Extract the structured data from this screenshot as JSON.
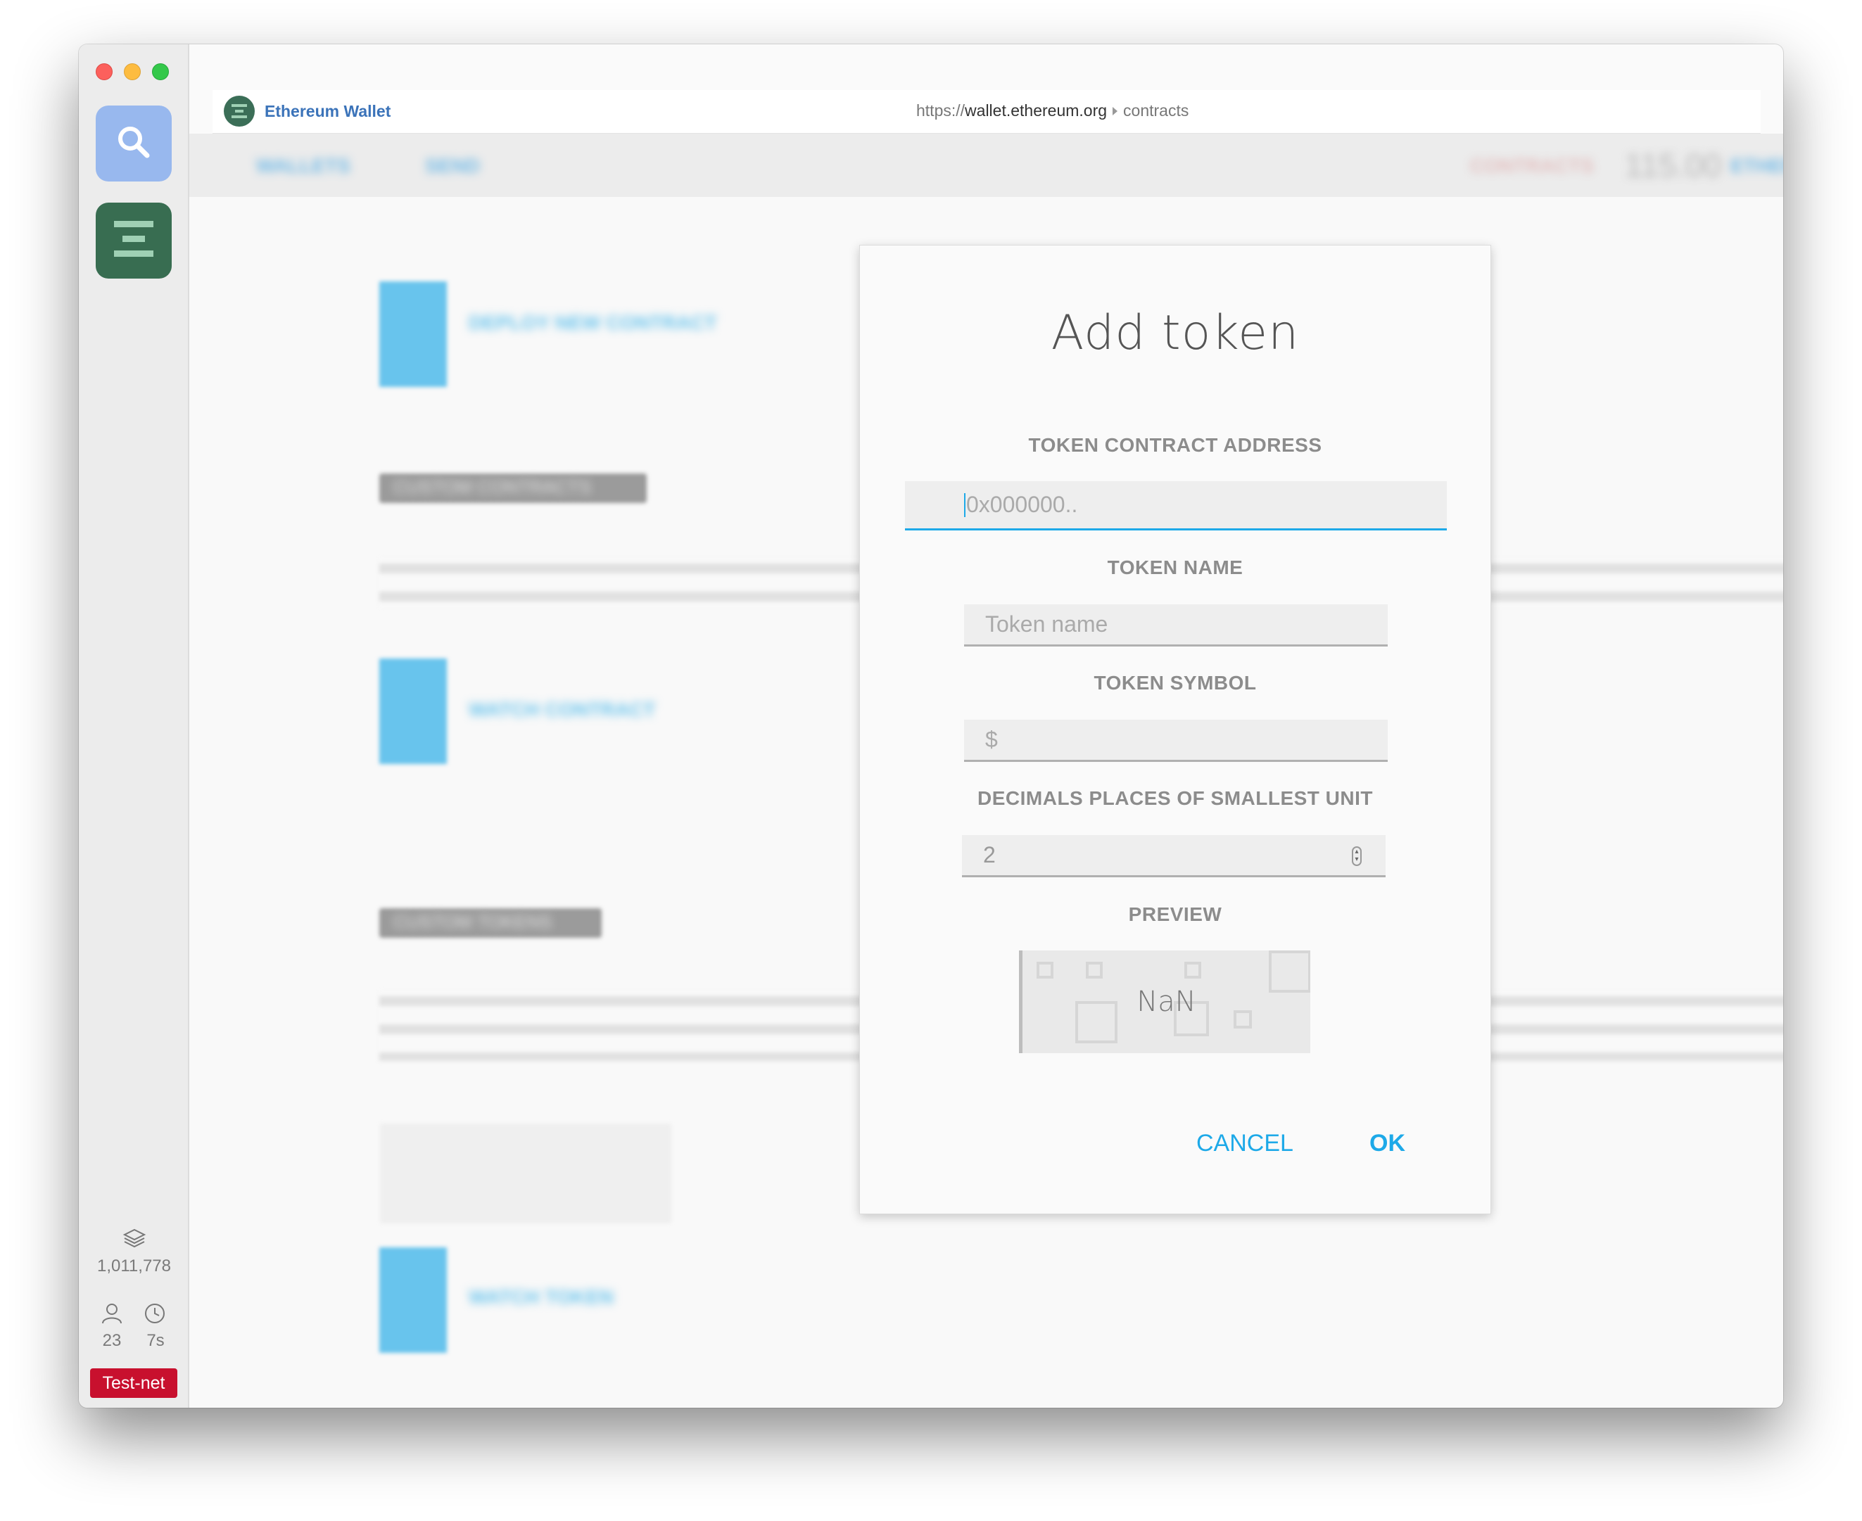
{
  "sidebar": {
    "block_number": "1,011,778",
    "peers": "23",
    "last_block": "7s",
    "network": "Test-net"
  },
  "browser": {
    "app_name": "Ethereum Wallet",
    "url_scheme": "https://",
    "url_domain": "wallet.ethereum.org",
    "url_path": "contracts"
  },
  "background": {
    "nav": [
      "WALLETS",
      "SEND",
      "CONTRACTS",
      "ETHER"
    ],
    "balance": "115.00",
    "deploy_label": "DEPLOY NEW CONTRACT",
    "custom_contracts_heading": "CUSTOM CONTRACTS",
    "watch_contract_label": "WATCH CONTRACT",
    "custom_tokens_heading": "CUSTOM TOKENS",
    "watch_token_label": "WATCH TOKEN"
  },
  "dialog": {
    "title": "Add token",
    "address_label": "TOKEN CONTRACT ADDRESS",
    "address_placeholder": "0x000000..",
    "name_label": "TOKEN NAME",
    "name_placeholder": "Token name",
    "symbol_label": "TOKEN SYMBOL",
    "symbol_placeholder": "$",
    "decimals_label": "DECIMALS PLACES OF SMALLEST UNIT",
    "decimals_value": "2",
    "preview_label": "PREVIEW",
    "preview_value": "NaN",
    "cancel_label": "CANCEL",
    "ok_label": "OK"
  },
  "colors": {
    "accent": "#1da9e8",
    "testnet_badge": "#c8102e",
    "wallet_icon": "#386d51",
    "search_icon_bg": "#98b8ee"
  }
}
